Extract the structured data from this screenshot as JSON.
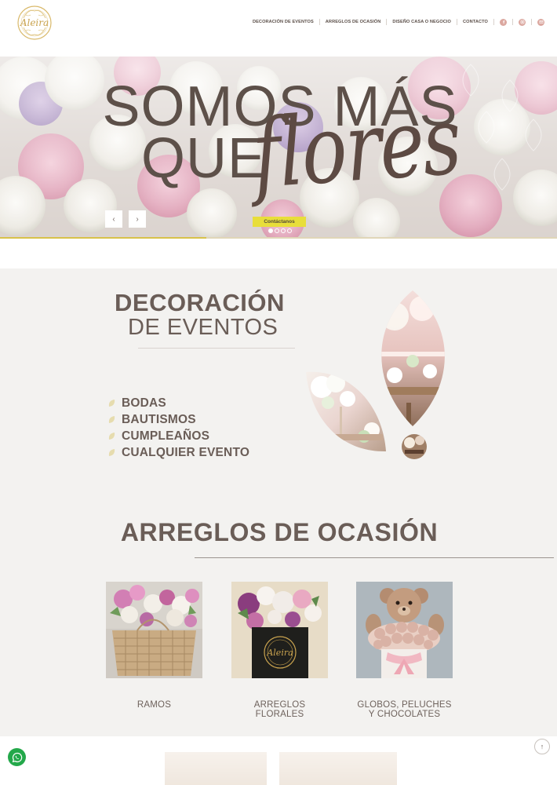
{
  "header": {
    "logo_text": "Aleira",
    "nav": [
      {
        "label": "Decoración de eventos"
      },
      {
        "label": "Arreglos de ocasión"
      },
      {
        "label": "Diseño casa o negocio"
      },
      {
        "label": "Contacto"
      }
    ],
    "social": [
      {
        "icon": "facebook-icon"
      },
      {
        "icon": "instagram-icon"
      },
      {
        "icon": "email-icon"
      }
    ],
    "social_color": "#dba79f"
  },
  "hero": {
    "line1": "SOMOS MÁS",
    "line2": "QUE",
    "script_word": "flores",
    "cta_label": "Contáctanos",
    "prev_icon": "‹",
    "next_icon": "›",
    "slide_count": 4,
    "active_slide": 1,
    "progress": 0.37,
    "accent_color": "#e8de3a"
  },
  "decoracion": {
    "title_line1": "DECORACIÓN",
    "title_line2": "DE EVENTOS",
    "items": [
      "BODAS",
      "BAUTISMOS",
      "CUMPLEAÑOS",
      "CUALQUIER EVENTO"
    ]
  },
  "arreglos": {
    "title": "ARREGLOS DE OCASIÓN",
    "cards": [
      {
        "label": "RAMOS"
      },
      {
        "label": "ARREGLOS FLORALES"
      },
      {
        "label": "GLOBOS, PELUCHES Y CHOCOLATES"
      }
    ]
  },
  "floating": {
    "whatsapp_icon": "whatsapp-icon",
    "scroll_top_icon": "↑",
    "whatsapp_color": "#23a84a"
  }
}
